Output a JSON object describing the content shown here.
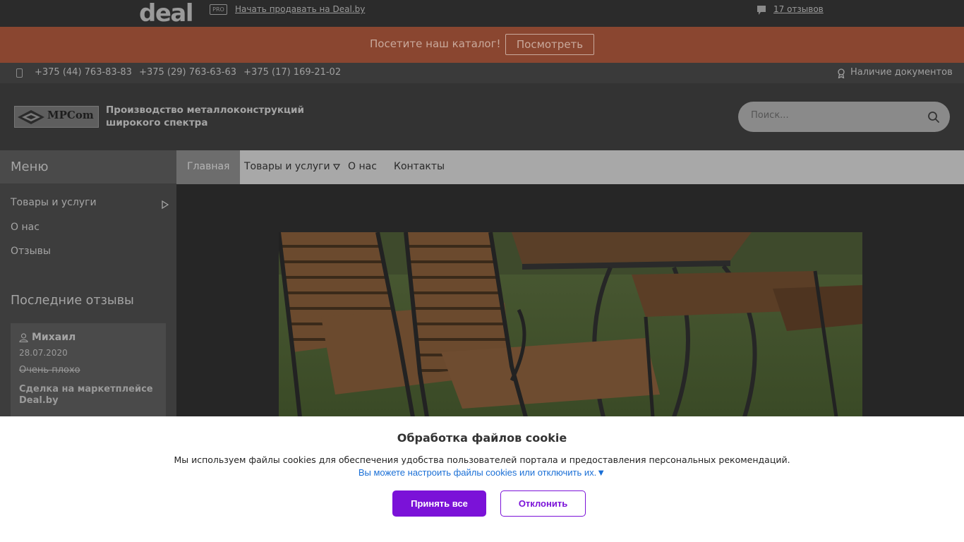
{
  "topbar": {
    "logo_text": "deal",
    "pro_label": "PRO",
    "sell_link": "Начать продавать на Deal.by",
    "reviews_link": "17 отзывов",
    "reviews_icon": "comment-icon"
  },
  "promo": {
    "text": "Посетите наш каталог!",
    "button": "Посмотреть"
  },
  "contacts": {
    "phone_icon": "mobile-phone-icon",
    "phones": [
      "+375 (44) 763-83-83",
      "+375 (29) 763-63-63",
      "+375 (17) 169-21-02"
    ],
    "docs_link": "Наличие документов",
    "docs_icon": "award-icon"
  },
  "header": {
    "logo_text": "MPCom",
    "company_title": "Производство металлоконструкций широкого спектра",
    "search_placeholder": "Поиск..."
  },
  "sidebar": {
    "menu_title": "Меню",
    "items": [
      {
        "label": "Товары и услуги",
        "has_submenu": true
      },
      {
        "label": "О нас"
      },
      {
        "label": "Отзывы"
      }
    ],
    "reviews_title": "Последние отзывы",
    "review": {
      "name": "Михаил",
      "date": "28.07.2020",
      "rating": "Очень плохо",
      "deal": "Сделка на маркетплейсе Deal.by"
    }
  },
  "nav": {
    "items": [
      {
        "label": "Главная",
        "active": true
      },
      {
        "label": "Товары и услуги",
        "dropdown": true
      },
      {
        "label": "О нас"
      },
      {
        "label": "Контакты"
      }
    ]
  },
  "cookie": {
    "title": "Обработка файлов cookie",
    "text": "Мы используем файлы cookies для обеспечения удобства пользователей портала и предоставления персональных рекомендаций.",
    "settings_link": "Вы можете настроить файлы cookies или отключить их.▼",
    "accept": "Принять все",
    "decline": "Отклонить"
  },
  "colors": {
    "promo_bg": "#8a4630",
    "accent_purple": "#7b12d8",
    "link_blue": "#1a6fd6"
  }
}
